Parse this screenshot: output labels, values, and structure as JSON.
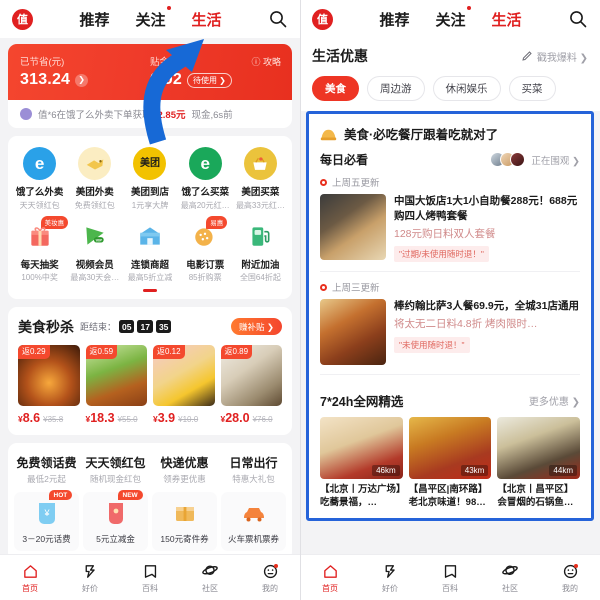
{
  "nav": {
    "logo_text": "值",
    "tabs": [
      {
        "label": "推荐",
        "active": false,
        "dot": false
      },
      {
        "label": "关注",
        "active": false,
        "dot": true
      },
      {
        "label": "生活",
        "active": true,
        "dot": false
      }
    ],
    "search_icon": "search-icon"
  },
  "left": {
    "banner": {
      "saved_label": "已节省(元)",
      "saved_value": "313.24",
      "subsidy_label": "贴金(元)",
      "subsidy_value": "0.92",
      "subsidy_chip": "待使用 ❯",
      "guide": "ⓘ 攻略"
    },
    "notice": {
      "prefix": "值*6在饿了么外卖下单获取",
      "amount": "2.85元",
      "suffix": "现金,6s前"
    },
    "grid": [
      {
        "name": "饿了么外卖",
        "sub": "天天领红包",
        "icon": "eleme-icon",
        "color": "#2aa1e8",
        "glyph": "e",
        "badge": ""
      },
      {
        "name": "美团外卖",
        "sub": "免费领红包",
        "icon": "meituan-waimai-icon",
        "color": "#f5cf5a",
        "glyph": "🦘",
        "badge": ""
      },
      {
        "name": "美团到店",
        "sub": "1元享大牌",
        "icon": "meituan-daodian-icon",
        "color": "#f2c200",
        "glyph": "美团",
        "badge": ""
      },
      {
        "name": "饿了么买菜",
        "sub": "最高20元红…",
        "icon": "eleme-maicai-icon",
        "color": "#1aa85a",
        "glyph": "e",
        "badge": ""
      },
      {
        "name": "美团买菜",
        "sub": "最高33元红…",
        "icon": "meituan-maicai-icon",
        "color": "#ebc33c",
        "glyph": "🧺",
        "badge": ""
      },
      {
        "name": "每天抽奖",
        "sub": "100%中奖",
        "icon": "gift-icon",
        "color": "#f46464",
        "glyph": "🎁",
        "badge": "美妆惠"
      },
      {
        "name": "视频会员",
        "sub": "最高30天会…",
        "icon": "video-vip-icon",
        "color": "#4cb64c",
        "glyph": "▶",
        "badge": ""
      },
      {
        "name": "连锁商超",
        "sub": "最高5折立减",
        "icon": "store-icon",
        "color": "#5ab4e8",
        "glyph": "🏪",
        "badge": ""
      },
      {
        "name": "电影订票",
        "sub": "85折购票",
        "icon": "movie-ticket-icon",
        "color": "#f0a63c",
        "glyph": "🎫",
        "badge": "易惠"
      },
      {
        "name": "附近加油",
        "sub": "全国64折起",
        "icon": "fuel-icon",
        "color": "#3ab87a",
        "glyph": "⛽",
        "badge": ""
      }
    ],
    "flash": {
      "title": "美食秒杀",
      "countdown_label": "距结束：",
      "countdown": [
        "05",
        "17",
        "35"
      ],
      "button": "赚补贴 ❯",
      "items": [
        {
          "badge": "返0.29",
          "now": "8.6",
          "old": "¥35.8",
          "image": "burger-image"
        },
        {
          "badge": "返0.59",
          "now": "18.3",
          "old": "¥55.0",
          "image": "skewers-image"
        },
        {
          "badge": "返0.12",
          "now": "3.9",
          "old": "¥10.0",
          "image": "dessert-image"
        },
        {
          "badge": "返0.89",
          "now": "28.0",
          "old": "¥76.0",
          "image": "rice-bowl-image"
        }
      ]
    },
    "promo": {
      "headers": [
        {
          "title": "免费领话费",
          "sub": "最低2元起"
        },
        {
          "title": "天天领红包",
          "sub": "随机现金红包"
        },
        {
          "title": "快递优惠",
          "sub": "领券更优惠"
        },
        {
          "title": "日常出行",
          "sub": "特惠大礼包"
        }
      ],
      "cells": [
        {
          "caption": "3－20元话费",
          "tag": "HOT",
          "icon": "phone-card-icon",
          "color": "#6fc5f0"
        },
        {
          "caption": "5元立减金",
          "tag": "NEW",
          "icon": "redpacket-icon",
          "color": "#f06a6a"
        },
        {
          "caption": "150元寄件券",
          "tag": "",
          "icon": "parcel-icon",
          "color": "#f0b95a"
        },
        {
          "caption": "火车票机票券",
          "tag": "",
          "icon": "car-icon",
          "color": "#f4833c"
        }
      ]
    }
  },
  "right": {
    "section": {
      "title": "生活优惠",
      "action": "戳我爆料 ❯",
      "pencil_icon": "pencil-icon"
    },
    "chips": [
      {
        "label": "美食",
        "active": true
      },
      {
        "label": "周边游",
        "active": false
      },
      {
        "label": "休闲娱乐",
        "active": false
      },
      {
        "label": "买菜",
        "active": false
      }
    ],
    "banner": {
      "icon": "food-hat-icon",
      "title": "美食·必吃餐厅跟着吃就对了"
    },
    "daily": {
      "title": "每日必看",
      "watching": "正在围观 ❯"
    },
    "items": [
      {
        "update": "上周五更新",
        "title": "中国大饭店1大1小自助餐288元！688元购四人烤鸭套餐",
        "sub": "128元购日料双人套餐",
        "tag": "\"过期/未使用随时退！\"",
        "image": "japanese-food-image"
      },
      {
        "update": "上周三更新",
        "title": "棒约翰比萨3人餐69.9元，全城31店通用",
        "sub": "将太无二日料4.8折  烤肉限时…",
        "tag": "\"未使用随时退！\"",
        "image": "bbq-platter-image"
      }
    ],
    "more": {
      "title": "7*24h全网精选",
      "action": "更多优惠 ❯"
    },
    "products": [
      {
        "distance": "46km",
        "name": "【北京丨万达广场】吃蕎景福，…",
        "image": "dessert-table-image"
      },
      {
        "distance": "43km",
        "name": "【昌平区|南环路】老北京味道！98…",
        "image": "hotpot-image"
      },
      {
        "distance": "44km",
        "name": "【北京丨昌平区】会冒烟的石锅鱼…",
        "image": "fish-pot-image"
      }
    ]
  },
  "tabbar": [
    {
      "label": "首页",
      "icon": "home-icon",
      "active": true,
      "dot": false
    },
    {
      "label": "好价",
      "icon": "price-tag-icon",
      "active": false,
      "dot": false
    },
    {
      "label": "百科",
      "icon": "book-icon",
      "active": false,
      "dot": false
    },
    {
      "label": "社区",
      "icon": "planet-icon",
      "active": false,
      "dot": false
    },
    {
      "label": "我的",
      "icon": "profile-icon",
      "active": false,
      "dot": true
    }
  ],
  "annotation": {
    "arrow_color": "#1769d6",
    "arrow_target": "生活"
  }
}
